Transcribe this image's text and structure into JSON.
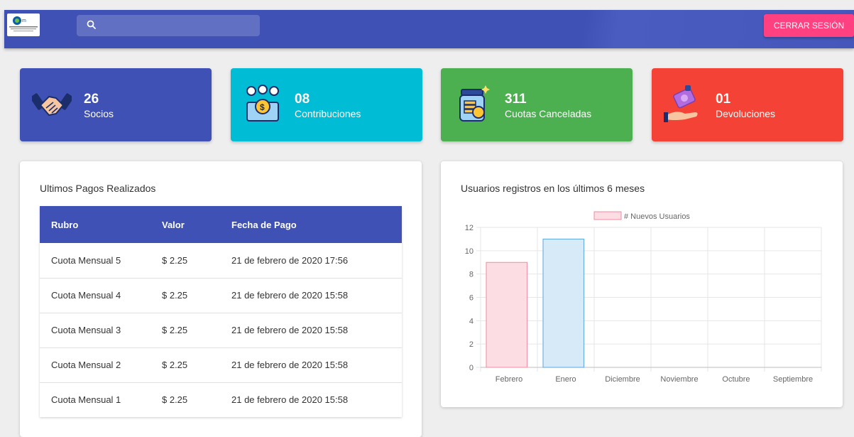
{
  "topbar": {
    "search_placeholder": "",
    "logout_label": "CERRAR SESIÓN",
    "accent": "#3f51b5",
    "logout_color": "#ff4081"
  },
  "stats": [
    {
      "value": "26",
      "label": "Socios",
      "icon": "handshake-icon",
      "color": "#3f51b5"
    },
    {
      "value": "08",
      "label": "Contribuciones",
      "icon": "contribution-icon",
      "color": "#00bcd4"
    },
    {
      "value": "311",
      "label": "Cuotas Canceladas",
      "icon": "coin-jar-icon",
      "color": "#4caf50"
    },
    {
      "value": "01",
      "label": "Devoluciones",
      "icon": "money-hand-icon",
      "color": "#f44336"
    }
  ],
  "payments": {
    "title": "Ultimos Pagos Realizados",
    "headers": [
      "Rubro",
      "Valor",
      "Fecha de Pago"
    ],
    "rows": [
      [
        "Cuota Mensual 5",
        "$ 2.25",
        "21 de febrero de 2020 17:56"
      ],
      [
        "Cuota Mensual 4",
        "$ 2.25",
        "21 de febrero de 2020 15:58"
      ],
      [
        "Cuota Mensual 3",
        "$ 2.25",
        "21 de febrero de 2020 15:58"
      ],
      [
        "Cuota Mensual 2",
        "$ 2.25",
        "21 de febrero de 2020 15:58"
      ],
      [
        "Cuota Mensual 1",
        "$ 2.25",
        "21 de febrero de 2020 15:58"
      ]
    ]
  },
  "users_chart": {
    "title": "Usuarios registros en los últimos 6 meses"
  },
  "chart_data": {
    "type": "bar",
    "title": "",
    "categories": [
      "Febrero",
      "Enero",
      "Diciembre",
      "Noviembre",
      "Octubre",
      "Septiembre"
    ],
    "series": [
      {
        "name": "# Nuevos Usuarios",
        "values": [
          9,
          11,
          0,
          0,
          0,
          0
        ]
      }
    ],
    "bar_fills": [
      "#fcdde3",
      "#d6eaf8",
      "#fcf1d5",
      "#d5f0f0",
      "#e5dcfa",
      "#ffe8d5"
    ],
    "bar_strokes": [
      "#f08ba0",
      "#5aa6e0",
      "#f5c85a",
      "#5ec2c2",
      "#9a70f0",
      "#ffa84d"
    ],
    "ylim": [
      0,
      12
    ],
    "yticks": [
      0,
      2,
      4,
      6,
      8,
      10,
      12
    ],
    "xlabel": "",
    "ylabel": "",
    "grid": true,
    "legend": "top-center"
  }
}
